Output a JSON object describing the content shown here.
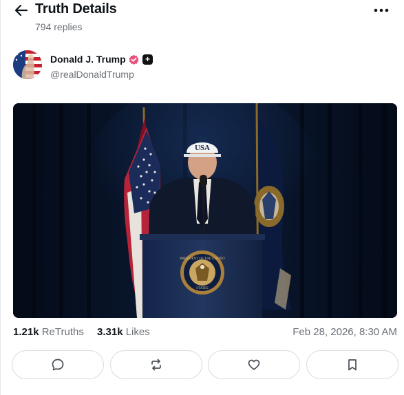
{
  "header": {
    "title": "Truth Details",
    "replies": "794 replies",
    "back_icon": "arrow-left-icon",
    "more_icon": "more-horizontal-icon"
  },
  "author": {
    "name": "Donald J. Trump",
    "handle": "@realDonaldTrump",
    "verified_icon": "verified-badge-icon",
    "plus_badge": "+",
    "verified_color": "#e8507c"
  },
  "post": {
    "media": {
      "cap_text": "USA",
      "seal_text_top": "PRESIDENT OF THE UNITED",
      "seal_text_bottom": "STATES"
    },
    "stats": {
      "retruths_count": "1.21k",
      "retruths_label": "ReTruths",
      "likes_count": "3.31k",
      "likes_label": "Likes"
    },
    "timestamp": "Feb 28, 2026, 8:30 AM"
  },
  "actions": [
    {
      "name": "reply",
      "icon": "chat-bubble-icon"
    },
    {
      "name": "retruth",
      "icon": "repost-arrows-icon"
    },
    {
      "name": "like",
      "icon": "heart-icon"
    },
    {
      "name": "bookmark",
      "icon": "bookmark-icon"
    }
  ],
  "colors": {
    "text_primary": "#0f1419",
    "text_secondary": "#6b6f76",
    "border": "#d9dbe0"
  }
}
